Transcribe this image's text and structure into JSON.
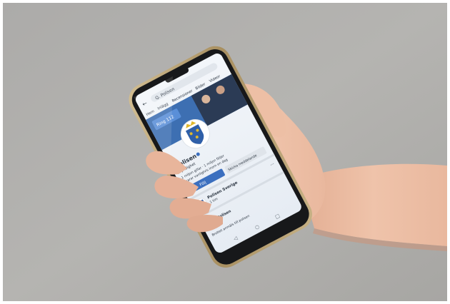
{
  "photo": {
    "background_color": "#aeadab",
    "frame_color": "#ffffff",
    "phone_frame_color": "#b8a37a",
    "phone_body_color": "#17181a",
    "hand_color": "#e8b9a0",
    "sleeve_color": "#ffffff"
  },
  "app": {
    "theme": "facebook-style page",
    "accent_color": "#3b6fbf",
    "top_bar": {
      "back_icon": "arrow-left-icon",
      "search_text": "Q. Polisen"
    },
    "tabs": [
      "Hem",
      "Inlägg",
      "Recensioner",
      "Bilder",
      "Videor"
    ],
    "cover_badge": "Ring 112",
    "page_name": "Polisen",
    "verified_icon": "verified-badge-icon",
    "category": "Myndighet",
    "info_lines": [
      "1 miljon gillar · 1 miljon följer",
      "Svarar vanligtvis inom en dag"
    ],
    "buttons": [
      "Följ",
      "Skicka meddelande"
    ],
    "post": {
      "author": "Polisen Sverige",
      "meta": "1 tim",
      "footer_author": "Polisen",
      "footer_text": "Brottet anmäls till polisen"
    },
    "nav_icons": [
      "back-icon",
      "home-icon",
      "recent-apps-icon"
    ]
  }
}
